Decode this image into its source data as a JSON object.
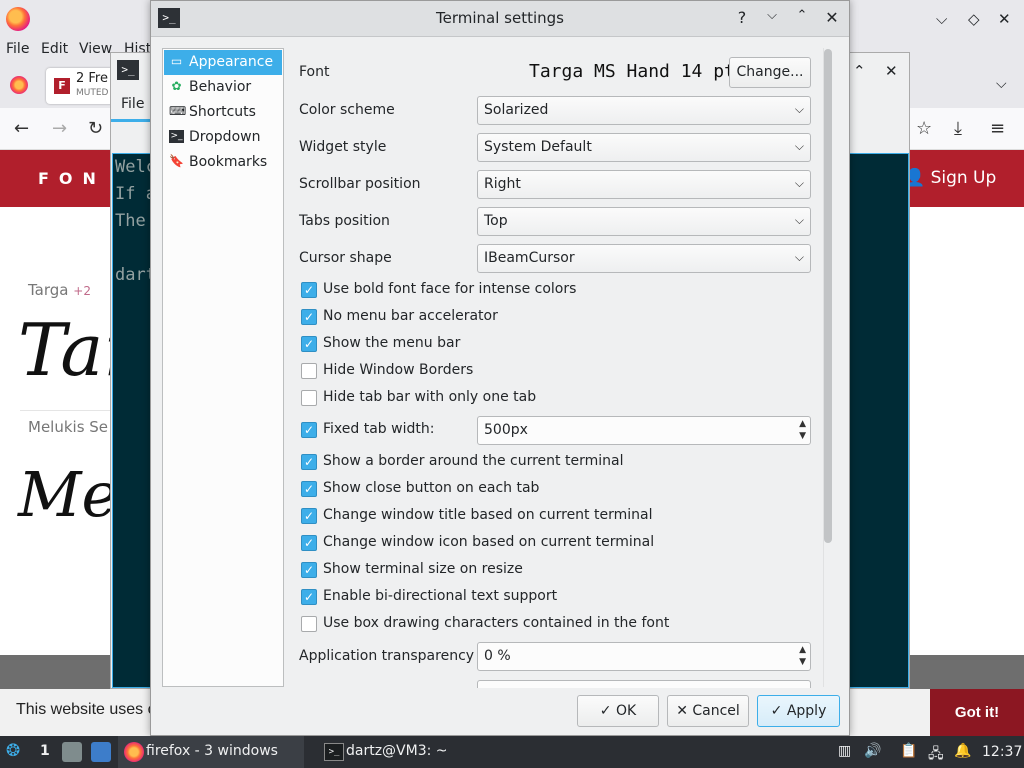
{
  "firefox": {
    "menu": [
      "File",
      "Edit",
      "View",
      "Hist"
    ],
    "tab_title": "2 Fre",
    "tab_sub": "MUTED",
    "signup": "Sign Up",
    "logo": "FON",
    "font1_name": "Targa",
    "font1_plus": "+2",
    "font1_sample": "Tar",
    "font2_name": "Melukis Se",
    "font2_sample": "Mel",
    "cookie_text": "This website uses c",
    "cookie_button": "Got it!"
  },
  "konsole": {
    "file_menu": "File",
    "lines": [
      "Welc",
      "If a",
      "The",
      "",
      "dart"
    ]
  },
  "dialog": {
    "title": "Terminal settings",
    "sidebar": [
      {
        "label": "Appearance",
        "icon": "appearance-icon",
        "selected": true
      },
      {
        "label": "Behavior",
        "icon": "behavior-icon",
        "selected": false
      },
      {
        "label": "Shortcuts",
        "icon": "shortcuts-icon",
        "selected": false
      },
      {
        "label": "Dropdown",
        "icon": "dropdown-icon",
        "selected": false
      },
      {
        "label": "Bookmarks",
        "icon": "bookmarks-icon",
        "selected": false
      }
    ],
    "font_label": "Font",
    "font_value": "Targa MS Hand 14 pt",
    "change_button": "Change...",
    "combos": [
      {
        "label": "Color scheme",
        "value": "Solarized"
      },
      {
        "label": "Widget style",
        "value": "System Default"
      },
      {
        "label": "Scrollbar position",
        "value": "Right"
      },
      {
        "label": "Tabs position",
        "value": "Top"
      },
      {
        "label": "Cursor shape",
        "value": "IBeamCursor"
      }
    ],
    "checks_a": [
      {
        "label": "Use bold font face for intense colors",
        "checked": true
      },
      {
        "label": "No menu bar accelerator",
        "checked": true
      },
      {
        "label": "Show the menu bar",
        "checked": true
      },
      {
        "label": "Hide Window Borders",
        "checked": false
      },
      {
        "label": "Hide tab bar with only one tab",
        "checked": false
      }
    ],
    "fixed_tab": {
      "label": "Fixed tab width:",
      "checked": true,
      "value": "500px"
    },
    "checks_b": [
      {
        "label": "Show a border around the current terminal",
        "checked": true
      },
      {
        "label": "Show close button on each tab",
        "checked": true
      },
      {
        "label": "Change window title based on current terminal",
        "checked": true
      },
      {
        "label": "Change window icon based on current terminal",
        "checked": true
      },
      {
        "label": "Show terminal size on resize",
        "checked": true
      },
      {
        "label": "Enable bi-directional text support",
        "checked": true
      },
      {
        "label": "Use box drawing characters contained in the font",
        "checked": false
      }
    ],
    "transparency": {
      "label": "Application transparency",
      "value": "0 %"
    },
    "buttons": {
      "ok": "OK",
      "cancel": "Cancel",
      "apply": "Apply"
    }
  },
  "taskbar": {
    "desktop_number": "1",
    "firefox_task": "firefox - 3 windows",
    "terminal_task": "dartz@VM3: ~",
    "clock": "12:37"
  },
  "colors": {
    "accent": "#3daee9",
    "site_red": "#b11f2c",
    "terminal_bg": "#002b36"
  }
}
